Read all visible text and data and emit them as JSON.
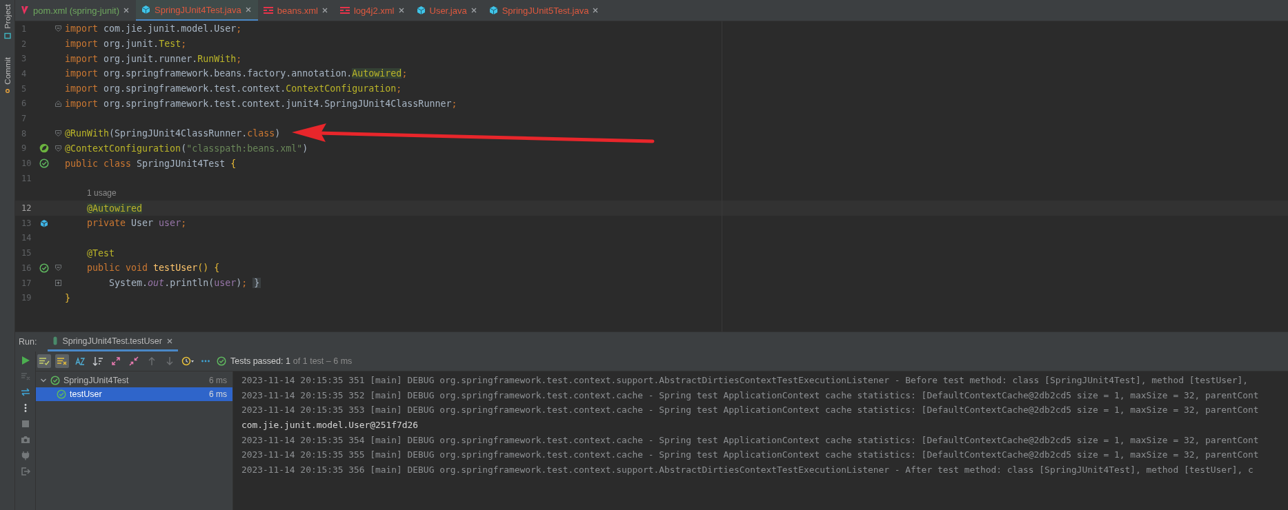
{
  "left_strip": [
    {
      "label": "Project",
      "kind": "project"
    },
    {
      "label": "Commit",
      "kind": "commit"
    }
  ],
  "tabs": [
    {
      "label": "pom.xml (spring-junit)",
      "kind": "maven",
      "color": "#6fa85f",
      "selected": false
    },
    {
      "label": "SpringJUnit4Test.java",
      "kind": "java",
      "color": "#e0593f",
      "selected": true
    },
    {
      "label": "beans.xml",
      "kind": "xml",
      "color": "#e0593f",
      "selected": false
    },
    {
      "label": "log4j2.xml",
      "kind": "xml",
      "color": "#e0593f",
      "selected": false
    },
    {
      "label": "User.java",
      "kind": "java",
      "color": "#e0593f",
      "selected": false
    },
    {
      "label": "SpringJUnit5Test.java",
      "kind": "java",
      "color": "#e0593f",
      "selected": false
    }
  ],
  "editor": {
    "lines": [
      {
        "kind": "code",
        "number": "1",
        "fold": {
          "kind": "open"
        },
        "current": false,
        "tokens": [
          {
            "kind": "kw",
            "text": "import"
          },
          {
            "kind": "plain",
            "text": " com.jie.junit.model.User"
          },
          {
            "kind": "punct",
            "text": ";"
          }
        ]
      },
      {
        "kind": "code",
        "number": "2",
        "current": false,
        "tokens": [
          {
            "kind": "kw",
            "text": "import"
          },
          {
            "kind": "plain",
            "text": " org.junit."
          },
          {
            "kind": "ann",
            "text": "Test"
          },
          {
            "kind": "punct",
            "text": ";"
          }
        ]
      },
      {
        "kind": "code",
        "number": "3",
        "current": false,
        "tokens": [
          {
            "kind": "kw",
            "text": "import"
          },
          {
            "kind": "plain",
            "text": " org.junit.runner."
          },
          {
            "kind": "ann",
            "text": "RunWith"
          },
          {
            "kind": "punct",
            "text": ";"
          }
        ]
      },
      {
        "kind": "code",
        "number": "4",
        "current": false,
        "tokens": [
          {
            "kind": "kw",
            "text": "import"
          },
          {
            "kind": "plain",
            "text": " org.springframework.beans.factory.annotation."
          },
          {
            "kind": "annhl",
            "text": "Autowired"
          },
          {
            "kind": "punct",
            "text": ";"
          }
        ]
      },
      {
        "kind": "code",
        "number": "5",
        "current": false,
        "tokens": [
          {
            "kind": "kw",
            "text": "import"
          },
          {
            "kind": "plain",
            "text": " org.springframework.test.context."
          },
          {
            "kind": "ann",
            "text": "ContextConfiguration"
          },
          {
            "kind": "punct",
            "text": ";"
          }
        ]
      },
      {
        "kind": "code",
        "number": "6",
        "fold": {
          "kind": "close"
        },
        "current": false,
        "tokens": [
          {
            "kind": "kw",
            "text": "import"
          },
          {
            "kind": "plain",
            "text": " org.springframework.test.context.junit4.SpringJUnit4ClassRunner"
          },
          {
            "kind": "punct",
            "text": ";"
          }
        ]
      },
      {
        "kind": "code",
        "number": "7",
        "current": false
      },
      {
        "kind": "code",
        "number": "8",
        "fold": {
          "kind": "open"
        },
        "current": false,
        "tokens": [
          {
            "kind": "ann",
            "text": "@RunWith"
          },
          {
            "kind": "plain",
            "text": "(SpringJUnit4ClassRunner."
          },
          {
            "kind": "kw",
            "text": "class"
          },
          {
            "kind": "plain",
            "text": ")"
          }
        ]
      },
      {
        "kind": "code",
        "number": "9",
        "fold": {
          "kind": "open"
        },
        "marker": {
          "kind": "spring"
        },
        "current": false,
        "tokens": [
          {
            "kind": "ann",
            "text": "@ContextConfiguration"
          },
          {
            "kind": "plain",
            "text": "("
          },
          {
            "kind": "str",
            "text": "\"classpath:beans.xml\""
          },
          {
            "kind": "plain",
            "text": ")"
          }
        ]
      },
      {
        "kind": "code",
        "number": "10",
        "marker": {
          "kind": "passed"
        },
        "current": false,
        "tokens": [
          {
            "kind": "kw",
            "text": "public class "
          },
          {
            "kind": "plain",
            "text": "SpringJUnit4Test "
          },
          {
            "kind": "brace",
            "text": "{"
          }
        ]
      },
      {
        "kind": "code",
        "number": "11",
        "current": false
      },
      {
        "kind": "hint",
        "text": "1 usage"
      },
      {
        "kind": "code",
        "number": "12",
        "current": true,
        "tokens": [
          {
            "kind": "annhl",
            "text": "    @Autowired"
          }
        ]
      },
      {
        "kind": "code",
        "number": "13",
        "marker": {
          "kind": "bean"
        },
        "current": false,
        "tokens": [
          {
            "kind": "kw",
            "text": "    private "
          },
          {
            "kind": "plain",
            "text": "User "
          },
          {
            "kind": "field",
            "text": "user"
          },
          {
            "kind": "punct",
            "text": ";"
          }
        ]
      },
      {
        "kind": "code",
        "number": "14",
        "current": false
      },
      {
        "kind": "code",
        "number": "15",
        "current": false,
        "tokens": [
          {
            "kind": "ann",
            "text": "    @Test"
          }
        ]
      },
      {
        "kind": "code",
        "number": "16",
        "fold": {
          "kind": "open"
        },
        "marker": {
          "kind": "passed"
        },
        "current": false,
        "tokens": [
          {
            "kind": "kw",
            "text": "    public void "
          },
          {
            "kind": "decl",
            "text": "testUser"
          },
          {
            "kind": "brace",
            "text": "() {"
          }
        ]
      },
      {
        "kind": "code",
        "number": "17",
        "fold": {
          "kind": "collapsed"
        },
        "current": false,
        "tokens": [
          {
            "kind": "plain",
            "text": "        System."
          },
          {
            "kind": "static",
            "text": "out"
          },
          {
            "kind": "plain",
            "text": ".println("
          },
          {
            "kind": "field",
            "text": "user"
          },
          {
            "kind": "plain",
            "text": ")"
          },
          {
            "kind": "punct",
            "text": ";"
          },
          {
            "kind": "folded",
            "text": " }"
          }
        ]
      },
      {
        "kind": "code",
        "number": "19",
        "current": false,
        "tokens": [
          {
            "kind": "brace",
            "text": "}"
          }
        ]
      }
    ]
  },
  "run": {
    "label": "Run:",
    "tab": {
      "label": "SpringJUnit4Test.testUser",
      "selected": true
    },
    "side": [
      {
        "kind": "run",
        "disabled": false
      },
      {
        "kind": "rerun-failed",
        "disabled": true
      },
      {
        "kind": "auto-test",
        "disabled": false
      },
      {
        "kind": "more-vertical",
        "disabled": false
      },
      {
        "kind": "stop",
        "disabled": true
      },
      {
        "kind": "camera",
        "disabled": true
      },
      {
        "kind": "plug",
        "disabled": true
      },
      {
        "kind": "exit",
        "disabled": true
      }
    ],
    "toolbar": [
      {
        "kind": "show-passed",
        "on": true,
        "disabled": false
      },
      {
        "kind": "show-ignored",
        "on": true,
        "disabled": false
      },
      {
        "kind": "sort-alpha",
        "on": false,
        "disabled": false
      },
      {
        "kind": "sort-duration",
        "on": false,
        "disabled": false
      },
      {
        "kind": "expand",
        "on": false,
        "disabled": false
      },
      {
        "kind": "collapse",
        "on": false,
        "disabled": false
      },
      {
        "kind": "prev",
        "on": false,
        "disabled": true
      },
      {
        "kind": "next",
        "on": false,
        "disabled": true
      },
      {
        "kind": "history",
        "on": false,
        "disabled": false
      },
      {
        "kind": "more",
        "on": false,
        "disabled": false
      }
    ],
    "status": {
      "label": "Tests passed: 1",
      "detail": "of 1 test – 6 ms"
    },
    "tree": [
      {
        "label": "SpringJUnit4Test",
        "time": "6 ms",
        "expanded": true,
        "selected": false,
        "children": [
          {
            "label": "testUser",
            "time": "6 ms",
            "selected": true
          }
        ]
      }
    ],
    "log": [
      {
        "kind": "debug",
        "text": "2023-11-14 20:15:35 351 [main] DEBUG org.springframework.test.context.support.AbstractDirtiesContextTestExecutionListener - Before test method: class [SpringJUnit4Test], method [testUser],"
      },
      {
        "kind": "debug",
        "text": "2023-11-14 20:15:35 352 [main] DEBUG org.springframework.test.context.cache - Spring test ApplicationContext cache statistics: [DefaultContextCache@2db2cd5 size = 1, maxSize = 32, parentCont"
      },
      {
        "kind": "debug",
        "text": "2023-11-14 20:15:35 353 [main] DEBUG org.springframework.test.context.cache - Spring test ApplicationContext cache statistics: [DefaultContextCache@2db2cd5 size = 1, maxSize = 32, parentCont"
      },
      {
        "kind": "output",
        "text": "com.jie.junit.model.User@251f7d26"
      },
      {
        "kind": "debug",
        "text": "2023-11-14 20:15:35 354 [main] DEBUG org.springframework.test.context.cache - Spring test ApplicationContext cache statistics: [DefaultContextCache@2db2cd5 size = 1, maxSize = 32, parentCont"
      },
      {
        "kind": "debug",
        "text": "2023-11-14 20:15:35 355 [main] DEBUG org.springframework.test.context.cache - Spring test ApplicationContext cache statistics: [DefaultContextCache@2db2cd5 size = 1, maxSize = 32, parentCont"
      },
      {
        "kind": "debug",
        "text": "2023-11-14 20:15:35 356 [main] DEBUG org.springframework.test.context.support.AbstractDirtiesContextTestExecutionListener - After test method: class [SpringJUnit4Test], method [testUser], c"
      }
    ]
  }
}
